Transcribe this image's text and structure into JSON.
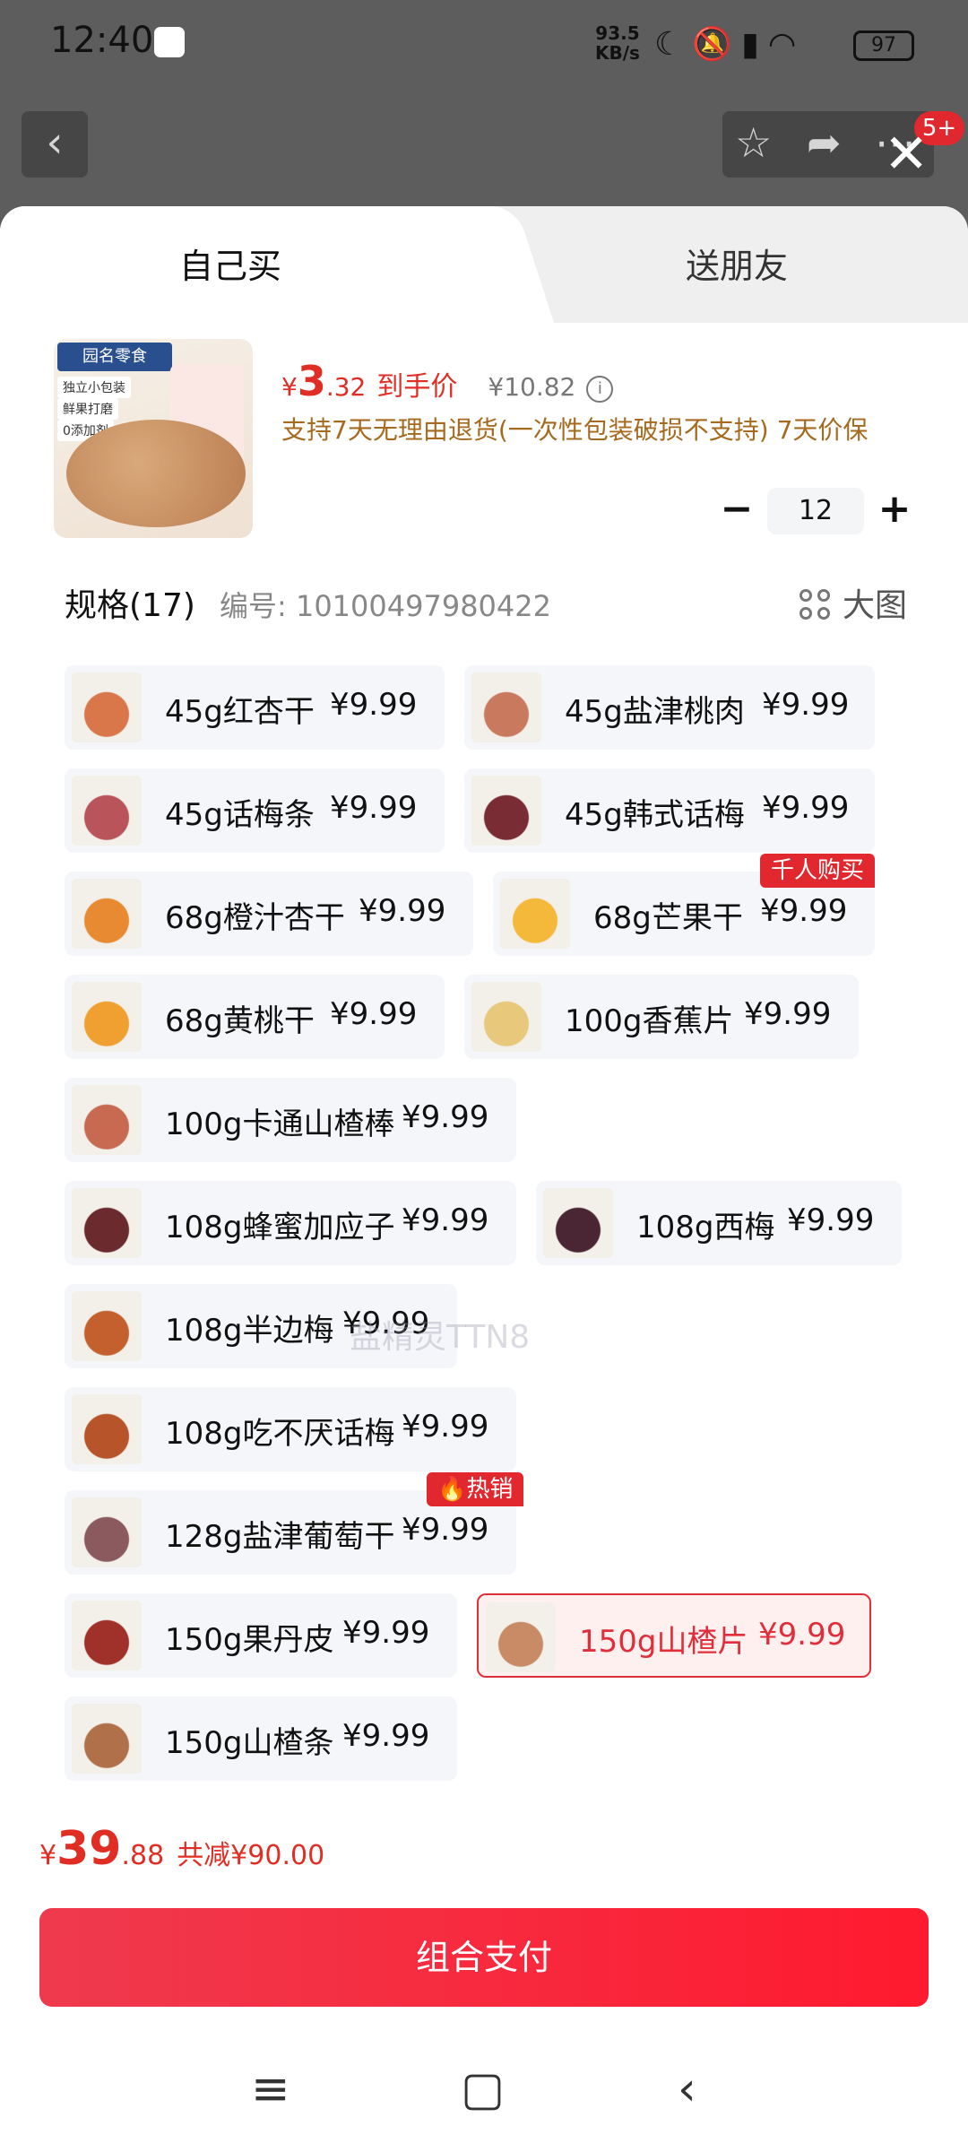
{
  "status_bar": {
    "time": "12:40",
    "net_speed": "93.5",
    "net_unit": "KB/s",
    "battery": "97",
    "icons": [
      "moon-icon",
      "mute-icon",
      "signal-icon",
      "wifi-icon"
    ]
  },
  "top_bar": {
    "badge": "5+"
  },
  "tabs": {
    "self": "自己买",
    "friend": "送朋友"
  },
  "product": {
    "image_brand": "园名零食",
    "image_tags": [
      "独立小包装",
      "鲜果打磨",
      "0添加剂"
    ],
    "price_yen": "¥",
    "price_int": "3",
    "price_dec": ".32",
    "price_label": "到手价",
    "original_price": "¥10.82",
    "policy": "支持7天无理由退货(一次性包装破损不支持)  7天价保",
    "quantity": "12"
  },
  "spec": {
    "title": "规格(17)",
    "code": "编号: 10100497980422",
    "big_view": "大图"
  },
  "options": [
    {
      "name": "45g红杏干",
      "price": "¥9.99"
    },
    {
      "name": "45g盐津桃肉",
      "price": "¥9.99"
    },
    {
      "name": "45g话梅条",
      "price": "¥9.99"
    },
    {
      "name": "45g韩式话梅",
      "price": "¥9.99"
    },
    {
      "name": "68g橙汁杏干",
      "price": "¥9.99"
    },
    {
      "name": "68g芒果干",
      "price": "¥9.99",
      "badge": "千人购买"
    },
    {
      "name": "68g黄桃干",
      "price": "¥9.99"
    },
    {
      "name": "100g香蕉片",
      "price": "¥9.99"
    },
    {
      "name": "100g卡通山楂棒",
      "price": "¥9.99"
    },
    {
      "name": "108g蜂蜜加应子",
      "price": "¥9.99"
    },
    {
      "name": "108g西梅",
      "price": "¥9.99"
    },
    {
      "name": "108g半边梅",
      "price": "¥9.99"
    },
    {
      "name": "108g吃不厌话梅",
      "price": "¥9.99"
    },
    {
      "name": "128g盐津葡萄干",
      "price": "¥9.99",
      "badge": "🔥热销"
    },
    {
      "name": "150g果丹皮",
      "price": "¥9.99"
    },
    {
      "name": "150g山楂片",
      "price": "¥9.99",
      "selected": true
    },
    {
      "name": "150g山楂条",
      "price": "¥9.99"
    }
  ],
  "watermark": "盐精灵TTN8",
  "footer": {
    "total_yen": "¥",
    "total_int": "39",
    "total_dec": ".88",
    "saving": "共减¥90.00",
    "pay_button": "组合支付"
  },
  "colors": {
    "accent": "#e02e24",
    "pay_button": "#ff1a2f",
    "policy_text": "#a66a1f",
    "option_bg": "#f4f6f9"
  }
}
